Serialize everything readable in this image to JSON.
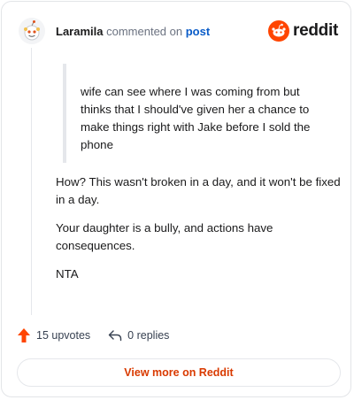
{
  "header": {
    "username": "Laramila",
    "action_text": "commented on",
    "post_link": "post",
    "brand": "reddit"
  },
  "comment": {
    "quote": "wife can see where I was coming from but thinks that I should've given her a chance to make things right with Jake before I sold the phone",
    "paragraphs": [
      "How? This wasn't broken in a day, and it won't be fixed in a day.",
      "Your daughter is a bully, and actions have consequences.",
      "NTA"
    ]
  },
  "actions": {
    "upvotes": "15 upvotes",
    "replies": "0 replies"
  },
  "footer": {
    "view_more": "View more on Reddit"
  },
  "colors": {
    "brand_orange": "#ff4500",
    "upvote": "#ff4500",
    "link_blue": "#0a5cc8",
    "button_text": "#d93a00"
  },
  "icons": {
    "avatar": "snoo-avatar",
    "brand": "reddit-logo",
    "upvote": "upvote-arrow-icon",
    "reply": "reply-icon"
  }
}
